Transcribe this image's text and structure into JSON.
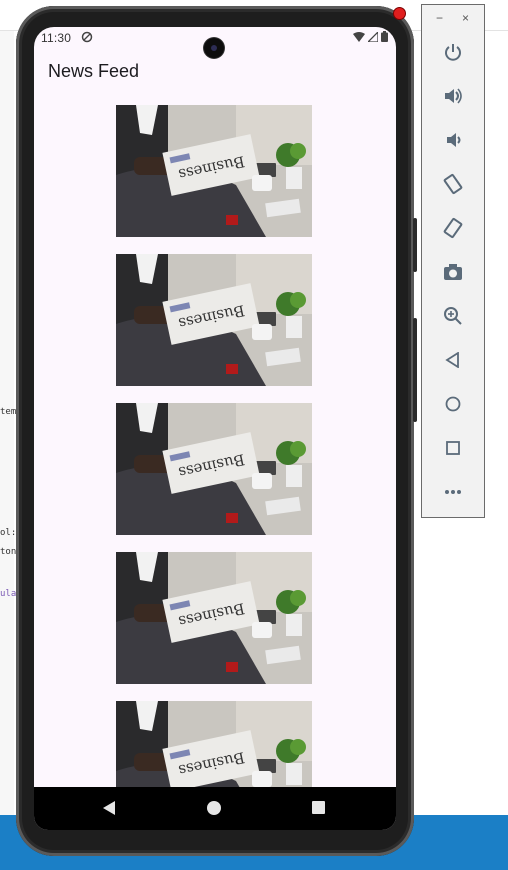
{
  "ide": {
    "code_fragments": [
      "tem",
      "ol:",
      "ton",
      "ula"
    ],
    "accent_color": "#1b7fc6"
  },
  "status_bar": {
    "time": "11:30",
    "icons": [
      "sync-icon",
      "wifi-icon",
      "signal-icon",
      "battery-icon"
    ]
  },
  "app": {
    "title": "News Feed",
    "background_color": "#fdf7fe"
  },
  "feed": {
    "items": [
      {
        "image": "business-newspaper-photo"
      },
      {
        "image": "business-newspaper-photo"
      },
      {
        "image": "business-newspaper-photo"
      },
      {
        "image": "business-newspaper-photo"
      },
      {
        "image": "business-newspaper-photo"
      }
    ],
    "newspaper_text": "Business"
  },
  "nav_bar": {
    "buttons": [
      "back",
      "home",
      "recents"
    ]
  },
  "emulator_toolbar": {
    "window_controls": {
      "minimize": "−",
      "close": "×"
    },
    "buttons": [
      "power",
      "volume-up",
      "volume-down",
      "rotate-left",
      "rotate-right",
      "screenshot",
      "zoom",
      "back",
      "home",
      "overview",
      "more"
    ]
  }
}
